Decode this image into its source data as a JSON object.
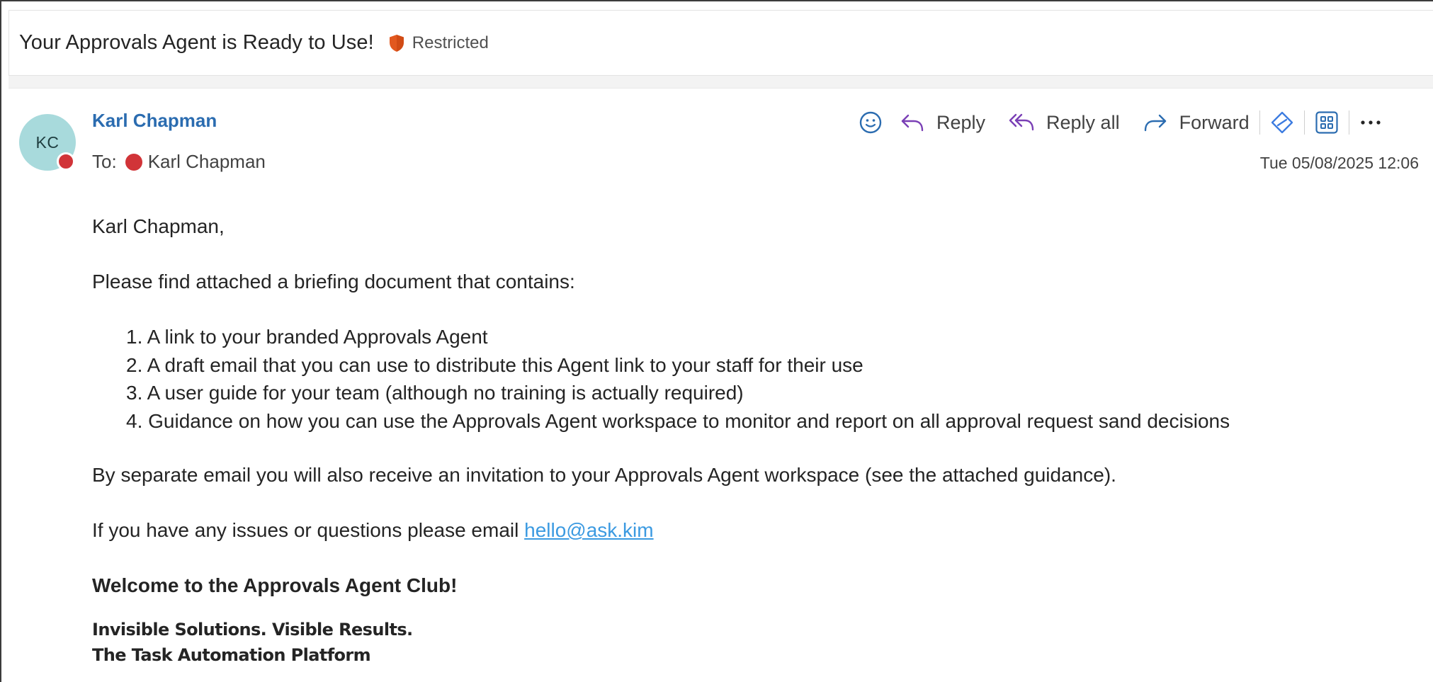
{
  "subject": {
    "title": "Your Approvals Agent is Ready to Use!",
    "sensitivity_label": "Restricted",
    "sensitivity_color": "#e2581f"
  },
  "sender": {
    "initials": "KC",
    "name": "Karl Chapman",
    "avatar_color": "#a8dadc",
    "presence_color": "#d13438"
  },
  "recipient": {
    "prefix": "To:",
    "name": "Karl Chapman"
  },
  "actions": {
    "emoji_icon": "smiley-icon",
    "reply": "Reply",
    "reply_all": "Reply all",
    "forward": "Forward",
    "loop_icon": "diamond-link-icon",
    "apps_icon": "apps-grid-icon",
    "more_icon": "more-ellipsis-icon"
  },
  "timestamp": "Tue 05/08/2025 12:06",
  "body": {
    "greeting": "Karl Chapman,",
    "intro": "Please find attached a briefing document that contains:",
    "items": [
      {
        "num": "1.",
        "text": "A link to your branded Approvals Agent"
      },
      {
        "num": "2.",
        "text": "A draft email that you can use to distribute this Agent link to your staff for their use"
      },
      {
        "num": "3.",
        "text": "A user guide for your team (although no training is actually required)"
      },
      {
        "num": "4.",
        "text": "Guidance on how you can use the Approvals Agent workspace to monitor and report on all approval request sand decisions"
      }
    ],
    "separate_email": "By separate email you will also receive an invitation to your Approvals Agent workspace (see the attached guidance).",
    "issues_prefix": "If you have any issues or questions please email ",
    "issues_email": "hello@ask.kim",
    "welcome": "Welcome to the Approvals Agent Club!",
    "tagline_1": "Invisible Solutions. Visible Results.",
    "tagline_2": "The Task Automation Platform"
  }
}
